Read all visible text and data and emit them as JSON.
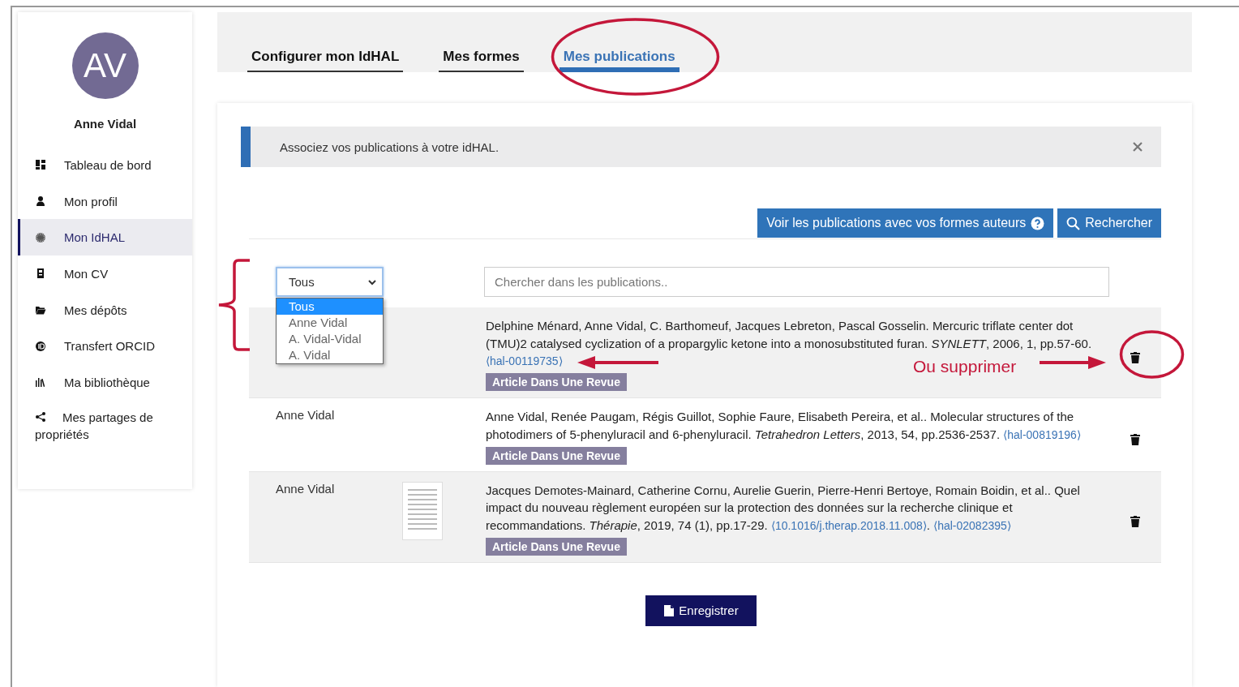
{
  "profile": {
    "initials": "AV",
    "name": "Anne Vidal"
  },
  "sidebar": {
    "items": [
      {
        "label": "Tableau de bord",
        "selected": false
      },
      {
        "label": "Mon profil",
        "selected": false
      },
      {
        "label": "Mon IdHAL",
        "selected": true
      },
      {
        "label": "Mon CV",
        "selected": false
      },
      {
        "label": "Mes dépôts",
        "selected": false
      },
      {
        "label": "Transfert ORCID",
        "selected": false
      },
      {
        "label": "Ma bibliothèque",
        "selected": false
      },
      {
        "label": "Mes partages de propriétés",
        "selected": false
      }
    ]
  },
  "tabs": [
    {
      "label": "Configurer mon IdHAL",
      "selected": false
    },
    {
      "label": "Mes formes",
      "selected": false
    },
    {
      "label": "Mes publications",
      "selected": true
    }
  ],
  "alert": {
    "text": "Associez vos publications à votre idHAL."
  },
  "actions": [
    {
      "label": "Voir les publications avec vos formes auteurs",
      "kind": "help"
    },
    {
      "label": "Rechercher",
      "kind": "search"
    }
  ],
  "filter": {
    "value": "Tous",
    "expanded": true,
    "options": [
      {
        "label": "Tous",
        "selected": true
      },
      {
        "label": "Anne Vidal",
        "selected": false
      },
      {
        "label": "A. Vidal-Vidal",
        "selected": false
      },
      {
        "label": "A. Vidal",
        "selected": false
      }
    ]
  },
  "search": {
    "placeholder": "Chercher dans les publications.."
  },
  "publications": [
    {
      "has_thumbnail": false,
      "citation": [
        {
          "kind": "text",
          "text": "Delphine Ménard, Anne Vidal, C. Barthomeuf, Jacques Lebreton, Pascal Gosselin. Mercuric triflate center dot (TMU)2 catalysed cyclization of a propargylic ketone into a monosubstituted furan. *SYNLETT*, 2006, 1, pp.57-60."
        },
        {
          "kind": "break"
        },
        {
          "kind": "link",
          "text": "⟨hal-00119735⟩"
        }
      ],
      "type": "Article Dans Une Revue"
    },
    {
      "author": "Anne Vidal",
      "has_thumbnail": false,
      "citation": [
        {
          "kind": "text",
          "text": "Anne Vidal, Renée Paugam, Régis Guillot, Sophie Faure, Elisabeth Pereira, et al.. Molecular structures of the photodimers of 5-phenyluracil and 6-phenyluracil. *Tetrahedron Letters*, 2013, 54, pp.2536-2537. "
        },
        {
          "kind": "link",
          "text": "⟨hal-00819196⟩"
        }
      ],
      "type": "Article Dans Une Revue"
    },
    {
      "author": "Anne Vidal",
      "has_thumbnail": true,
      "citation": [
        {
          "kind": "text",
          "text": "Jacques Demotes-Mainard, Catherine Cornu, Aurelie Guerin, Pierre-Henri Bertoye, Romain Boidin, et al.. Quel impact du nouveau règlement européen sur la protection des données sur la recherche clinique et recommandations. *Thérapie*, 2019, 74 (1), pp.17-29. "
        },
        {
          "kind": "link",
          "text": "⟨10.1016/j.therap.2018.11.008⟩"
        },
        {
          "kind": "text",
          "text": ". "
        },
        {
          "kind": "link",
          "text": "⟨hal-02082395⟩"
        }
      ],
      "type": "Article Dans Une Revue"
    }
  ],
  "save_button": {
    "label": "Enregistrer"
  },
  "annotation": {
    "label": "Ou supprimer"
  }
}
